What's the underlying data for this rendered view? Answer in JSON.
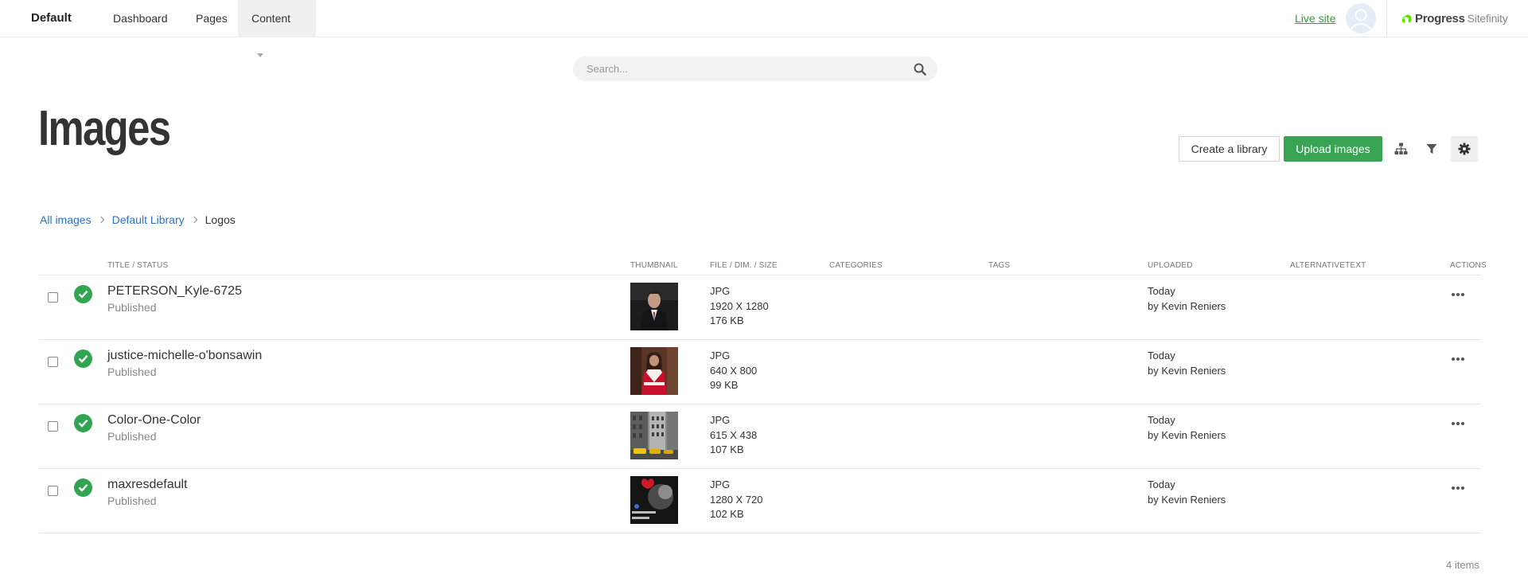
{
  "topbar": {
    "site_name": "Default",
    "nav": [
      {
        "label": "Dashboard"
      },
      {
        "label": "Pages"
      },
      {
        "label": "Content"
      }
    ],
    "live_site": "Live site",
    "brand_progress": "Progress",
    "brand_sitefinity": "Sitefinity"
  },
  "search": {
    "placeholder": "Search...",
    "value": ""
  },
  "page": {
    "title": "Images"
  },
  "toolbar": {
    "create_label": "Create a library",
    "upload_label": "Upload images",
    "icons": [
      "hierarchy-icon",
      "filter-icon",
      "gear-icon"
    ]
  },
  "breadcrumb": {
    "items": [
      "All images",
      "Default Library"
    ],
    "current": "Logos"
  },
  "table": {
    "columns": [
      "TITLE / STATUS",
      "THUMBNAIL",
      "FILE / DIM. / SIZE",
      "CATEGORIES",
      "TAGS",
      "UPLOADED",
      "ALTERNATIVETEXT",
      "ACTIONS"
    ],
    "rows": [
      {
        "title": "PETERSON_Kyle-6725",
        "status": "Published",
        "type": "JPG",
        "dimensions": "1920 X 1280",
        "size": "176 KB",
        "uploaded": "Today",
        "uploaded_by": "by Kevin Reniers"
      },
      {
        "title": "justice-michelle-o'bonsawin",
        "status": "Published",
        "type": "JPG",
        "dimensions": "640 X 800",
        "size": "99 KB",
        "uploaded": "Today",
        "uploaded_by": "by Kevin Reniers"
      },
      {
        "title": "Color-One-Color",
        "status": "Published",
        "type": "JPG",
        "dimensions": "615 X 438",
        "size": "107 KB",
        "uploaded": "Today",
        "uploaded_by": "by Kevin Reniers"
      },
      {
        "title": "maxresdefault",
        "status": "Published",
        "type": "JPG",
        "dimensions": "1280 X 720",
        "size": "102 KB",
        "uploaded": "Today",
        "uploaded_by": "by Kevin Reniers"
      }
    ],
    "count_label": "4 items"
  },
  "colors": {
    "accent_green": "#38a453",
    "status_green": "#2fa551",
    "link_blue": "#2a72c8"
  }
}
